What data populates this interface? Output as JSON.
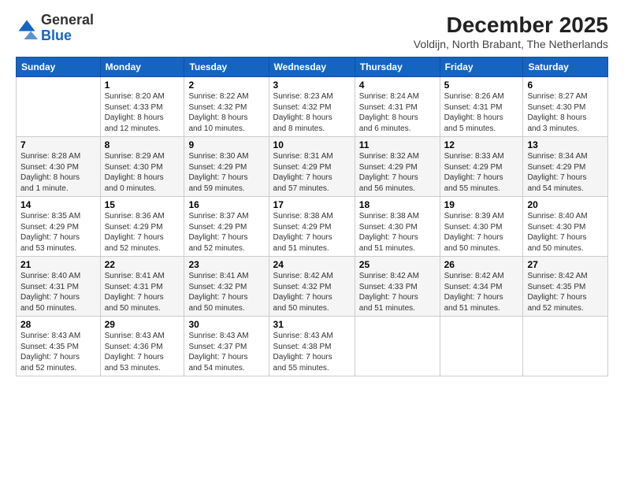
{
  "logo": {
    "general": "General",
    "blue": "Blue"
  },
  "title": {
    "month_year": "December 2025",
    "location": "Voldijn, North Brabant, The Netherlands"
  },
  "days_of_week": [
    "Sunday",
    "Monday",
    "Tuesday",
    "Wednesday",
    "Thursday",
    "Friday",
    "Saturday"
  ],
  "weeks": [
    [
      {
        "day": "",
        "info": ""
      },
      {
        "day": "1",
        "info": "Sunrise: 8:20 AM\nSunset: 4:33 PM\nDaylight: 8 hours\nand 12 minutes."
      },
      {
        "day": "2",
        "info": "Sunrise: 8:22 AM\nSunset: 4:32 PM\nDaylight: 8 hours\nand 10 minutes."
      },
      {
        "day": "3",
        "info": "Sunrise: 8:23 AM\nSunset: 4:32 PM\nDaylight: 8 hours\nand 8 minutes."
      },
      {
        "day": "4",
        "info": "Sunrise: 8:24 AM\nSunset: 4:31 PM\nDaylight: 8 hours\nand 6 minutes."
      },
      {
        "day": "5",
        "info": "Sunrise: 8:26 AM\nSunset: 4:31 PM\nDaylight: 8 hours\nand 5 minutes."
      },
      {
        "day": "6",
        "info": "Sunrise: 8:27 AM\nSunset: 4:30 PM\nDaylight: 8 hours\nand 3 minutes."
      }
    ],
    [
      {
        "day": "7",
        "info": "Sunrise: 8:28 AM\nSunset: 4:30 PM\nDaylight: 8 hours\nand 1 minute."
      },
      {
        "day": "8",
        "info": "Sunrise: 8:29 AM\nSunset: 4:30 PM\nDaylight: 8 hours\nand 0 minutes."
      },
      {
        "day": "9",
        "info": "Sunrise: 8:30 AM\nSunset: 4:29 PM\nDaylight: 7 hours\nand 59 minutes."
      },
      {
        "day": "10",
        "info": "Sunrise: 8:31 AM\nSunset: 4:29 PM\nDaylight: 7 hours\nand 57 minutes."
      },
      {
        "day": "11",
        "info": "Sunrise: 8:32 AM\nSunset: 4:29 PM\nDaylight: 7 hours\nand 56 minutes."
      },
      {
        "day": "12",
        "info": "Sunrise: 8:33 AM\nSunset: 4:29 PM\nDaylight: 7 hours\nand 55 minutes."
      },
      {
        "day": "13",
        "info": "Sunrise: 8:34 AM\nSunset: 4:29 PM\nDaylight: 7 hours\nand 54 minutes."
      }
    ],
    [
      {
        "day": "14",
        "info": "Sunrise: 8:35 AM\nSunset: 4:29 PM\nDaylight: 7 hours\nand 53 minutes."
      },
      {
        "day": "15",
        "info": "Sunrise: 8:36 AM\nSunset: 4:29 PM\nDaylight: 7 hours\nand 52 minutes."
      },
      {
        "day": "16",
        "info": "Sunrise: 8:37 AM\nSunset: 4:29 PM\nDaylight: 7 hours\nand 52 minutes."
      },
      {
        "day": "17",
        "info": "Sunrise: 8:38 AM\nSunset: 4:29 PM\nDaylight: 7 hours\nand 51 minutes."
      },
      {
        "day": "18",
        "info": "Sunrise: 8:38 AM\nSunset: 4:30 PM\nDaylight: 7 hours\nand 51 minutes."
      },
      {
        "day": "19",
        "info": "Sunrise: 8:39 AM\nSunset: 4:30 PM\nDaylight: 7 hours\nand 50 minutes."
      },
      {
        "day": "20",
        "info": "Sunrise: 8:40 AM\nSunset: 4:30 PM\nDaylight: 7 hours\nand 50 minutes."
      }
    ],
    [
      {
        "day": "21",
        "info": "Sunrise: 8:40 AM\nSunset: 4:31 PM\nDaylight: 7 hours\nand 50 minutes."
      },
      {
        "day": "22",
        "info": "Sunrise: 8:41 AM\nSunset: 4:31 PM\nDaylight: 7 hours\nand 50 minutes."
      },
      {
        "day": "23",
        "info": "Sunrise: 8:41 AM\nSunset: 4:32 PM\nDaylight: 7 hours\nand 50 minutes."
      },
      {
        "day": "24",
        "info": "Sunrise: 8:42 AM\nSunset: 4:32 PM\nDaylight: 7 hours\nand 50 minutes."
      },
      {
        "day": "25",
        "info": "Sunrise: 8:42 AM\nSunset: 4:33 PM\nDaylight: 7 hours\nand 51 minutes."
      },
      {
        "day": "26",
        "info": "Sunrise: 8:42 AM\nSunset: 4:34 PM\nDaylight: 7 hours\nand 51 minutes."
      },
      {
        "day": "27",
        "info": "Sunrise: 8:42 AM\nSunset: 4:35 PM\nDaylight: 7 hours\nand 52 minutes."
      }
    ],
    [
      {
        "day": "28",
        "info": "Sunrise: 8:43 AM\nSunset: 4:35 PM\nDaylight: 7 hours\nand 52 minutes."
      },
      {
        "day": "29",
        "info": "Sunrise: 8:43 AM\nSunset: 4:36 PM\nDaylight: 7 hours\nand 53 minutes."
      },
      {
        "day": "30",
        "info": "Sunrise: 8:43 AM\nSunset: 4:37 PM\nDaylight: 7 hours\nand 54 minutes."
      },
      {
        "day": "31",
        "info": "Sunrise: 8:43 AM\nSunset: 4:38 PM\nDaylight: 7 hours\nand 55 minutes."
      },
      {
        "day": "",
        "info": ""
      },
      {
        "day": "",
        "info": ""
      },
      {
        "day": "",
        "info": ""
      }
    ]
  ]
}
